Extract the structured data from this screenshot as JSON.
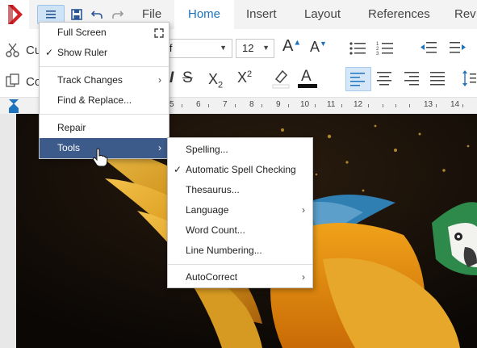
{
  "titlebar": {
    "file_label": "File",
    "tabs": [
      "Home",
      "Insert",
      "Layout",
      "References",
      "Rev"
    ]
  },
  "ribbon": {
    "cut_label": "Cu",
    "copy_label": "Co",
    "font_name_fragment": "if",
    "font_size": "12"
  },
  "ruler": {
    "numbers": [
      "5",
      "6",
      "7",
      "8",
      "9",
      "10",
      "11",
      "12",
      "13",
      "14"
    ]
  },
  "main_menu": {
    "items": [
      {
        "label": "Full Screen"
      },
      {
        "label": "Show Ruler",
        "checked": true
      },
      {
        "label": "Track Changes",
        "submenu": true
      },
      {
        "label": "Find & Replace..."
      },
      {
        "label": "Repair"
      },
      {
        "label": "Tools",
        "submenu": true,
        "highlighted": true
      }
    ]
  },
  "tools_menu": {
    "items": [
      {
        "label": "Spelling..."
      },
      {
        "label": "Automatic Spell Checking",
        "checked": true
      },
      {
        "label": "Thesaurus..."
      },
      {
        "label": "Language",
        "submenu": true
      },
      {
        "label": "Word Count..."
      },
      {
        "label": "Line Numbering..."
      },
      {
        "label": "AutoCorrect",
        "submenu": true
      }
    ]
  },
  "colors": {
    "accent": "#1e73be",
    "menu_highlight": "#3c5a8a",
    "logo": "#d3232a"
  }
}
